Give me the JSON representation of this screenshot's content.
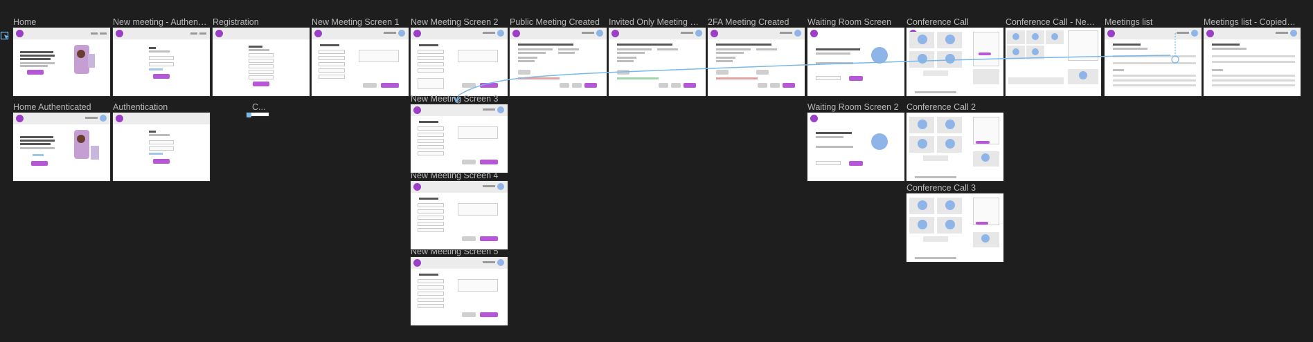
{
  "toolbar": {
    "icon": "frame-select-icon"
  },
  "frames": [
    {
      "title": "Home"
    },
    {
      "title": "New meeting - Authenti..."
    },
    {
      "title": "Registration"
    },
    {
      "title": "New Meeting Screen 1"
    },
    {
      "title": "New Meeting Screen 2"
    },
    {
      "title": "Public Meeting Created"
    },
    {
      "title": "Invited Only Meeting Cr..."
    },
    {
      "title": "2FA Meeting Created"
    },
    {
      "title": "Waiting Room Screen"
    },
    {
      "title": "Conference Call"
    },
    {
      "title": "Conference Call - New ..."
    },
    {
      "title": "Meetings list"
    },
    {
      "title": "Meetings list - Copied t..."
    },
    {
      "title": "Home Authenticated"
    },
    {
      "title": "Authentication"
    },
    {
      "title": "C..."
    },
    {
      "title": "New Meeting Screen 3"
    },
    {
      "title": "New Meeting Screen 4"
    },
    {
      "title": "New Meeting Screen 5"
    },
    {
      "title": "Waiting Room Screen 2"
    },
    {
      "title": "Conference Call 2"
    },
    {
      "title": "Conference Call 3"
    }
  ],
  "colors": {
    "canvas": "#1e1e1e",
    "accent": "#b557d6",
    "connector": "#7ab8e8"
  }
}
